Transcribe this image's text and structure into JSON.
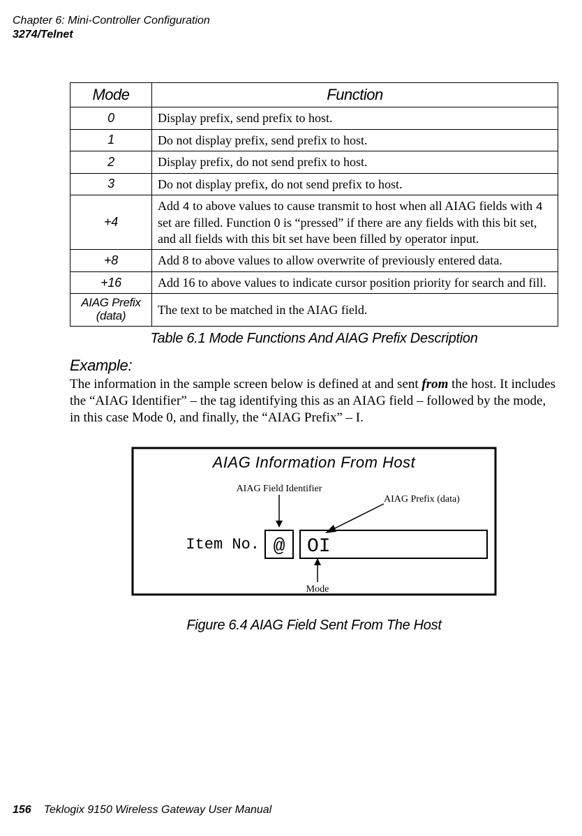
{
  "header": {
    "chapter_line": "Chapter 6: Mini-Controller Configuration",
    "section_line": "3274/Telnet"
  },
  "table": {
    "headers": {
      "mode": "Mode",
      "function": "Function"
    },
    "rows": [
      {
        "mode": "0",
        "func": "Display prefix, send prefix to host."
      },
      {
        "mode": "1",
        "func": "Do not display prefix, send prefix to host."
      },
      {
        "mode": "2",
        "func": "Display prefix, do not send prefix to host."
      },
      {
        "mode": "3",
        "func": "Do not display prefix, do not send prefix to host."
      },
      {
        "mode": "+4",
        "func_pre": "Add ",
        "func_four1": "4",
        "func_mid": " to above values to cause transmit to host when all AIAG fields with ",
        "func_four2": "4",
        "func_post": " set are filled. Function 0 is “pressed” if there are any fields with this bit set, and all fields with this bit set have been filled by operator input."
      },
      {
        "mode": "+8",
        "func": "Add 8 to above values to allow overwrite of previously entered data."
      },
      {
        "mode": "+16",
        "func": "Add 16 to above values to indicate cursor position priority for search and fill."
      },
      {
        "mode_line1": "AIAG Prefix",
        "mode_line2": "(data)",
        "func": "The text to be matched in the AIAG field."
      }
    ],
    "caption": "Table 6.1 Mode Functions And AIAG Prefix Description"
  },
  "example": {
    "heading": "Example:",
    "para_pre": "The information in the sample screen below is defined at and sent ",
    "para_from": "from",
    "para_post": " the host. It includes the “AIAG Identifier” – the tag identifying this as an AIAG field – followed by the mode, in this case Mode 0, and finally, the “AIAG Prefix” – I."
  },
  "figure": {
    "title": "AIAG Information From Host",
    "label_identifier": "AIAG Field Identifier",
    "label_prefix": "AIAG Prefix (data)",
    "label_mode": "Mode",
    "item_no": "Item No.",
    "at_sign": "@",
    "oi_text": "OI",
    "caption": "Figure 6.4 AIAG Field Sent From The Host"
  },
  "footer": {
    "page_number": "156",
    "text": "Teklogix 9150 Wireless Gateway User Manual"
  }
}
